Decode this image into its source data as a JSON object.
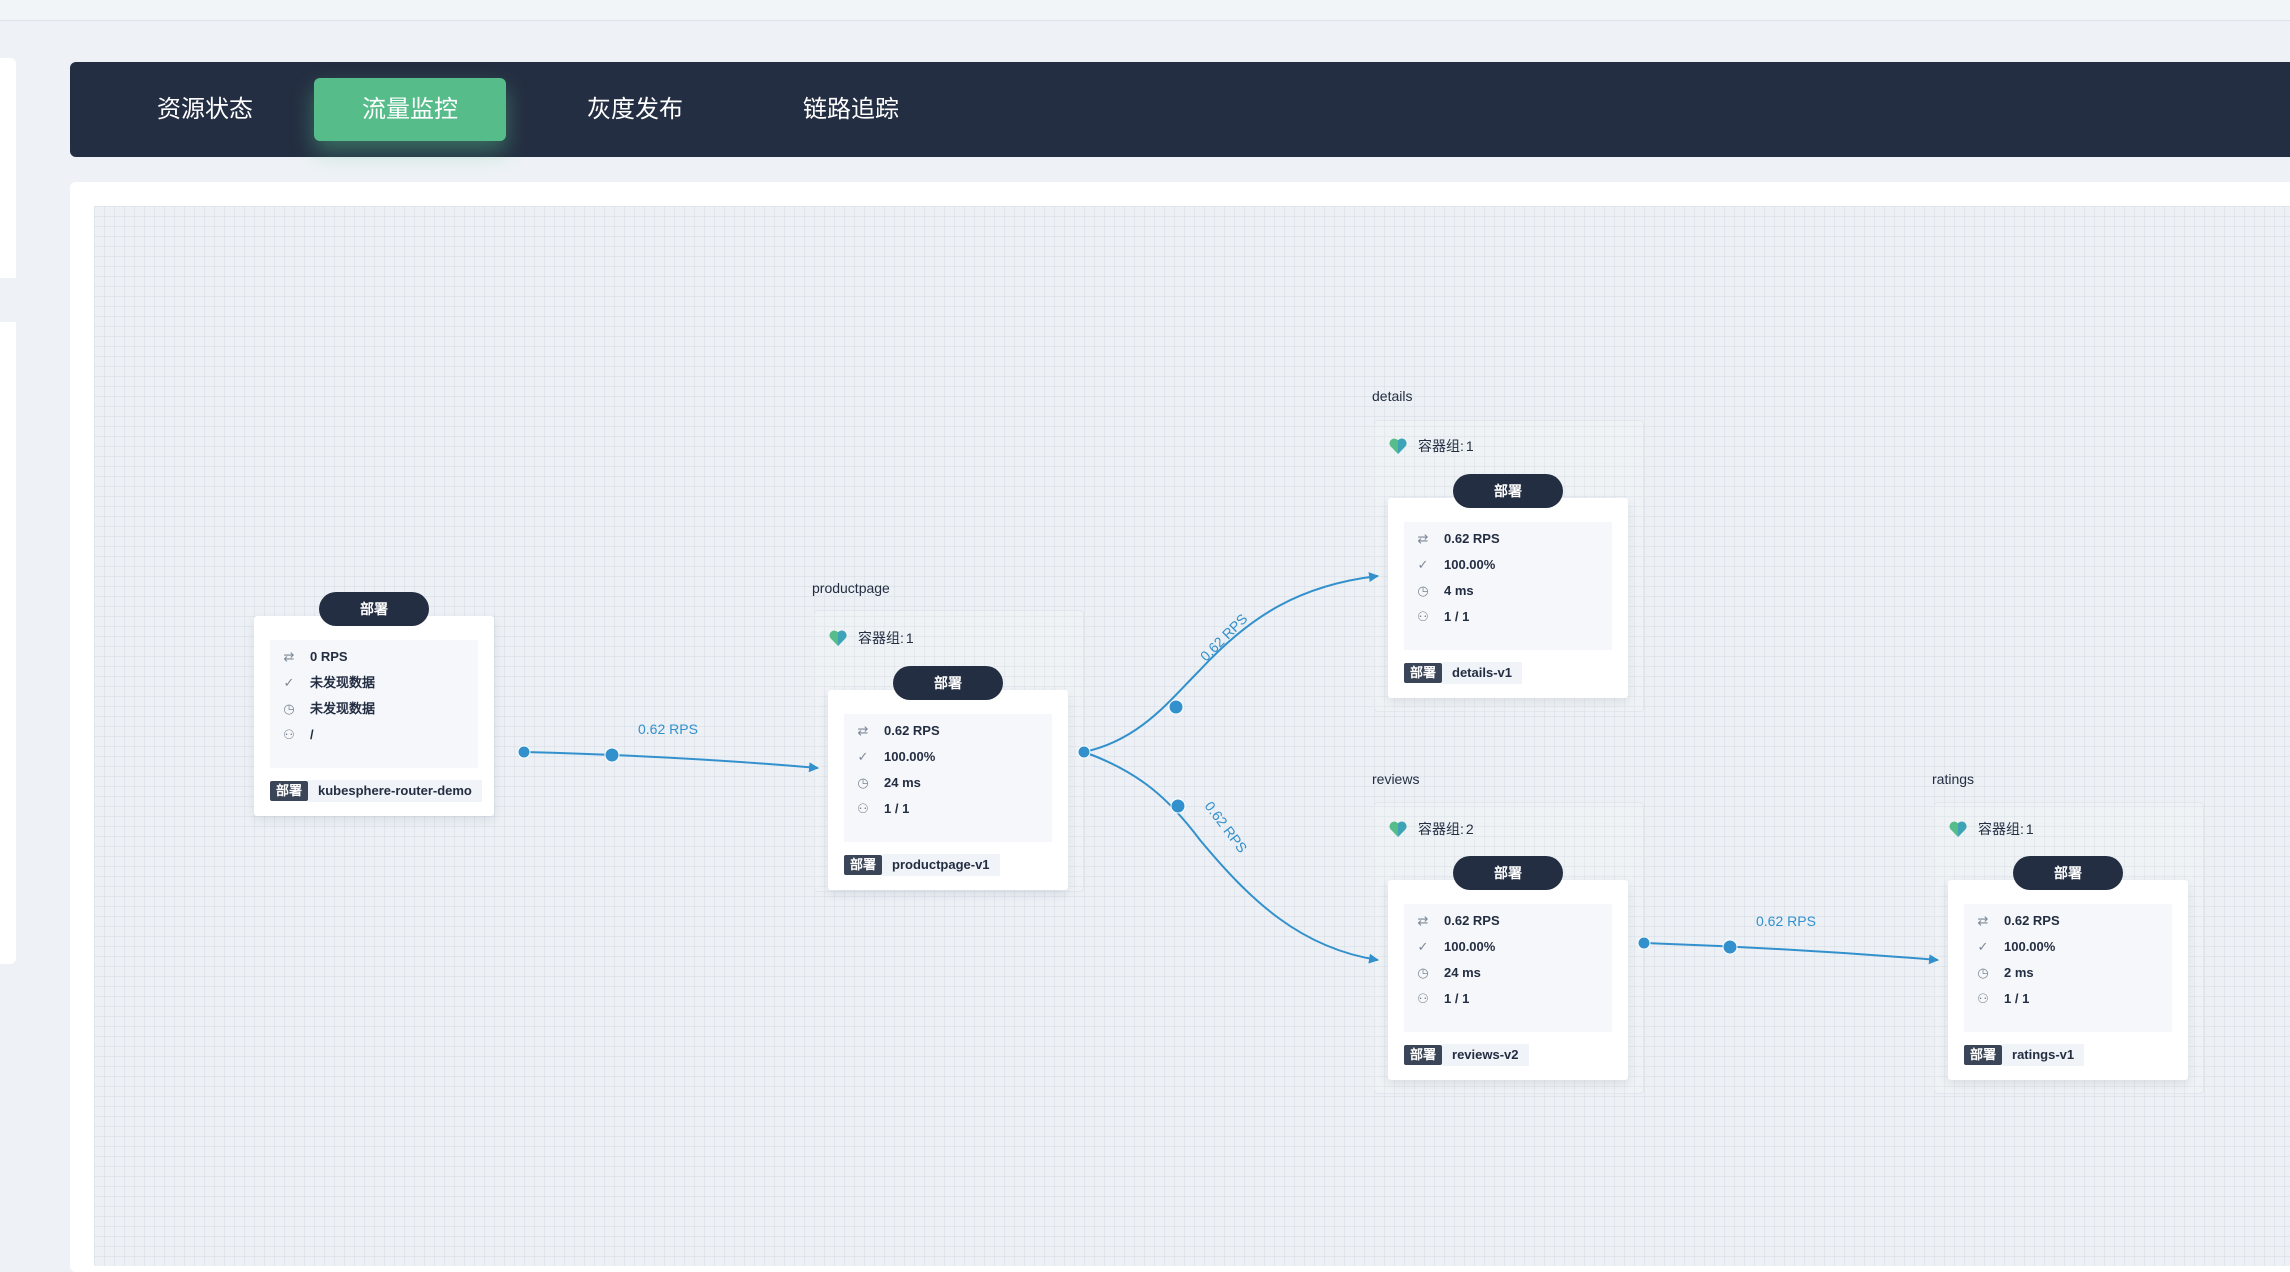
{
  "tabs": [
    {
      "label": "资源状态",
      "active": false
    },
    {
      "label": "流量监控",
      "active": true
    },
    {
      "label": "灰度发布",
      "active": false
    },
    {
      "label": "链路追踪",
      "active": false
    }
  ],
  "colors": {
    "accent": "#55bc8a",
    "dark": "#242e42",
    "edge": "#3290cc"
  },
  "icons": {
    "rps": "arrows-icon",
    "success": "check-icon",
    "latency": "clock-icon",
    "pods": "pods-icon",
    "health": "heart-icon"
  },
  "groups": [
    {
      "label": "productpage",
      "pods_prefix": "容器组:",
      "pods": "1"
    },
    {
      "label": "details",
      "pods_prefix": "容器组:",
      "pods": "1"
    },
    {
      "label": "reviews",
      "pods_prefix": "容器组:",
      "pods": "2"
    },
    {
      "label": "ratings",
      "pods_prefix": "容器组:",
      "pods": "1"
    }
  ],
  "nodes": [
    {
      "kind": "部署",
      "rps": "0 RPS",
      "success": "未发现数据",
      "latency": "未发现数据",
      "replicas": "/",
      "tag": "部署",
      "name": "kubesphere-router-demo"
    },
    {
      "kind": "部署",
      "rps": "0.62 RPS",
      "success": "100.00%",
      "latency": "24 ms",
      "replicas": "1 / 1",
      "tag": "部署",
      "name": "productpage-v1"
    },
    {
      "kind": "部署",
      "rps": "0.62 RPS",
      "success": "100.00%",
      "latency": "4 ms",
      "replicas": "1 / 1",
      "tag": "部署",
      "name": "details-v1"
    },
    {
      "kind": "部署",
      "rps": "0.62 RPS",
      "success": "100.00%",
      "latency": "24 ms",
      "replicas": "1 / 1",
      "tag": "部署",
      "name": "reviews-v2"
    },
    {
      "kind": "部署",
      "rps": "0.62 RPS",
      "success": "100.00%",
      "latency": "2 ms",
      "replicas": "1 / 1",
      "tag": "部署",
      "name": "ratings-v1"
    }
  ],
  "edges": [
    {
      "label": "0.62 RPS"
    },
    {
      "label": "0.62 RPS"
    },
    {
      "label": "0.62 RPS"
    },
    {
      "label": "0.62 RPS"
    }
  ]
}
